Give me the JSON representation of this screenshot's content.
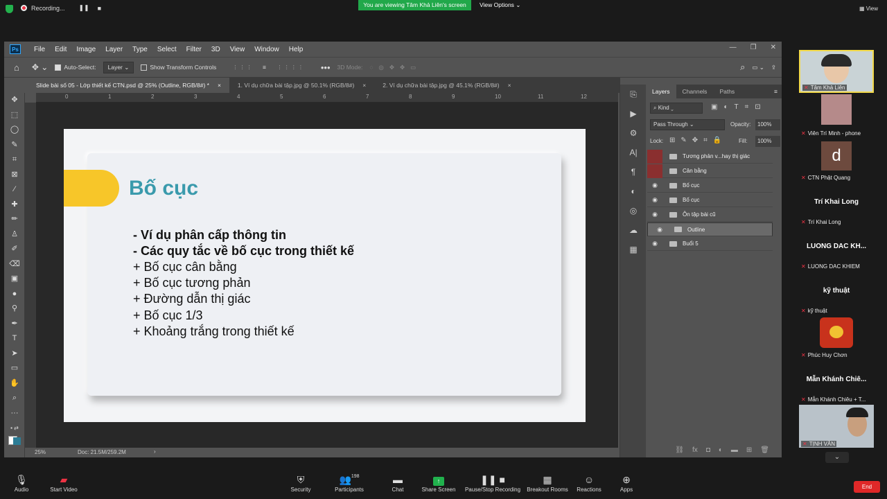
{
  "zoom": {
    "recording": "Recording...",
    "viewing_banner": "You are viewing Tâm Khả Liên's screen",
    "view_options": "View Options ⌄",
    "view_btn": "View",
    "bottom": {
      "audio": "Audio",
      "start_video": "Start Video",
      "security": "Security",
      "participants": "Participants",
      "participants_count": "198",
      "chat": "Chat",
      "share_screen": "Share Screen",
      "pause_recording": "Pause/Stop Recording",
      "breakout": "Breakout Rooms",
      "reactions": "Reactions",
      "apps": "Apps",
      "end": "End"
    },
    "participants": [
      {
        "name": "Tâm Khả Liên",
        "big": ""
      },
      {
        "name": "Viên Trí Minh - phone",
        "big": ""
      },
      {
        "name": "CTN Phật Quang",
        "big": "d"
      },
      {
        "name": "Trí Khai Long",
        "big": "Trí Khai Long"
      },
      {
        "name": "LUONG DAC KHIEM",
        "big": "LUONG DAC KH..."
      },
      {
        "name": "kỹ thuật",
        "big": "kỹ thuật"
      },
      {
        "name": "Phúc Huy Chơn",
        "big": ""
      },
      {
        "name": "Mẫn Khánh Chiêu + T...",
        "big": "Mẫn Khánh Chiê..."
      },
      {
        "name": "TỊNH VĂN",
        "big": ""
      }
    ]
  },
  "ps": {
    "logo": "Ps",
    "menus": [
      "File",
      "Edit",
      "Image",
      "Layer",
      "Type",
      "Select",
      "Filter",
      "3D",
      "View",
      "Window",
      "Help"
    ],
    "options": {
      "auto_select": "Auto-Select:",
      "layer": "Layer",
      "show_transform": "Show Transform Controls",
      "mode_3d": "3D Mode:"
    },
    "tabs": [
      "Slide bài số 05 - Lớp thiết kế CTN.psd @ 25% (Outline, RGB/8#) *",
      "1. Ví dụ chữa bài tập.jpg @ 50.1% (RGB/8#)",
      "2. Ví dụ chữa bài tập.jpg @ 45.1% (RGB/8#)"
    ],
    "ruler_numbers": [
      "0",
      "1",
      "2",
      "3",
      "4",
      "5",
      "6",
      "7",
      "8",
      "9",
      "10",
      "11",
      "12"
    ],
    "status": {
      "zoom": "25%",
      "doc": "Doc: 21.5M/259.2M"
    },
    "layers_panel": {
      "tabs": [
        "Layers",
        "Channels",
        "Paths"
      ],
      "kind": "Kind",
      "blend": "Pass Through",
      "opacity_label": "Opacity:",
      "opacity": "100%",
      "lock_label": "Lock:",
      "fill_label": "Fill:",
      "fill": "100%",
      "layers": [
        {
          "name": "Tương phản v...hay thị giác",
          "visible": false
        },
        {
          "name": "Cân bằng",
          "visible": false
        },
        {
          "name": "Bố cục",
          "visible": true
        },
        {
          "name": "Bố cục",
          "visible": true
        },
        {
          "name": "Ôn tập bài cũ",
          "visible": true
        },
        {
          "name": "Outline",
          "visible": true,
          "selected": true
        },
        {
          "name": "Buổi 5",
          "visible": true
        }
      ]
    }
  },
  "slide": {
    "title": "Bố cục",
    "lines": [
      "- Ví dụ phân cấp thông tin",
      "- Các quy tắc về bố cục trong thiết kế",
      "+ Bố cục cân bằng",
      "+ Bố cục tương phản",
      "+ Đường dẫn thị giác",
      "+ Bố cục 1/3",
      "+ Khoảng trắng trong thiết kế"
    ]
  }
}
